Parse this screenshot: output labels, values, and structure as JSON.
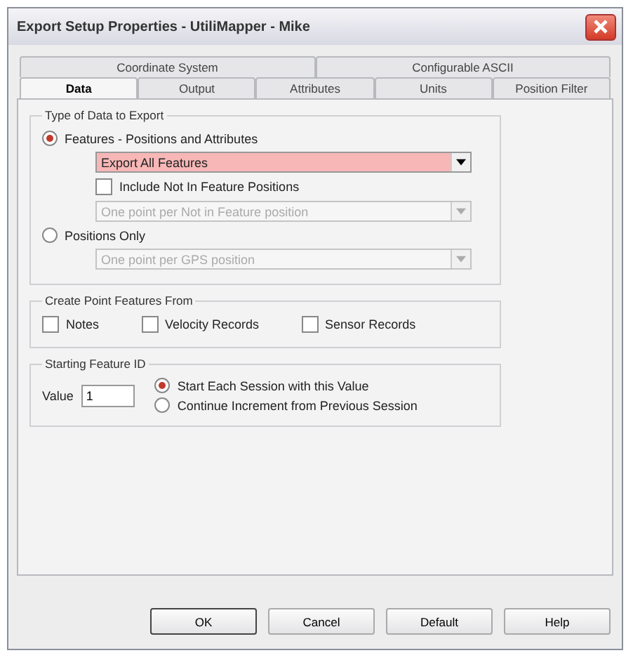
{
  "window": {
    "title": "Export Setup Properties - UtiliMapper - Mike"
  },
  "tab_rows": [
    {
      "tabs": [
        {
          "label": "Coordinate System",
          "selected": false
        },
        {
          "label": "Configurable ASCII",
          "selected": false
        }
      ]
    },
    {
      "tabs": [
        {
          "label": "Data",
          "selected": true
        },
        {
          "label": "Output",
          "selected": false
        },
        {
          "label": "Attributes",
          "selected": false
        },
        {
          "label": "Units",
          "selected": false
        },
        {
          "label": "Position Filter",
          "selected": false
        }
      ]
    }
  ],
  "type_of_data": {
    "title": "Type of Data to Export",
    "features_option": {
      "label": "Features - Positions and Attributes",
      "selected": true
    },
    "features_dropdown": {
      "value": "Export All Features",
      "disabled": false
    },
    "include_checkbox": {
      "label": "Include Not In Feature Positions",
      "checked": false
    },
    "include_dropdown": {
      "value": "One point per Not in Feature position",
      "disabled": true
    },
    "positions_option": {
      "label": "Positions Only",
      "selected": false
    },
    "positions_dropdown": {
      "value": "One point per GPS position",
      "disabled": true
    }
  },
  "create_point_features": {
    "title": "Create Point Features From",
    "checkboxes": [
      {
        "label": "Notes",
        "checked": false
      },
      {
        "label": "Velocity Records",
        "checked": false
      },
      {
        "label": "Sensor Records",
        "checked": false
      }
    ]
  },
  "starting_feature_id": {
    "title": "Starting Feature ID",
    "value_label": "Value",
    "value": "1",
    "options": [
      {
        "label": "Start Each Session with this Value",
        "selected": true
      },
      {
        "label": "Continue Increment from Previous Session",
        "selected": false
      }
    ]
  },
  "buttons": [
    {
      "label": "OK",
      "default": true
    },
    {
      "label": "Cancel",
      "default": false
    },
    {
      "label": "Default",
      "default": false
    },
    {
      "label": "Help",
      "default": false
    }
  ]
}
